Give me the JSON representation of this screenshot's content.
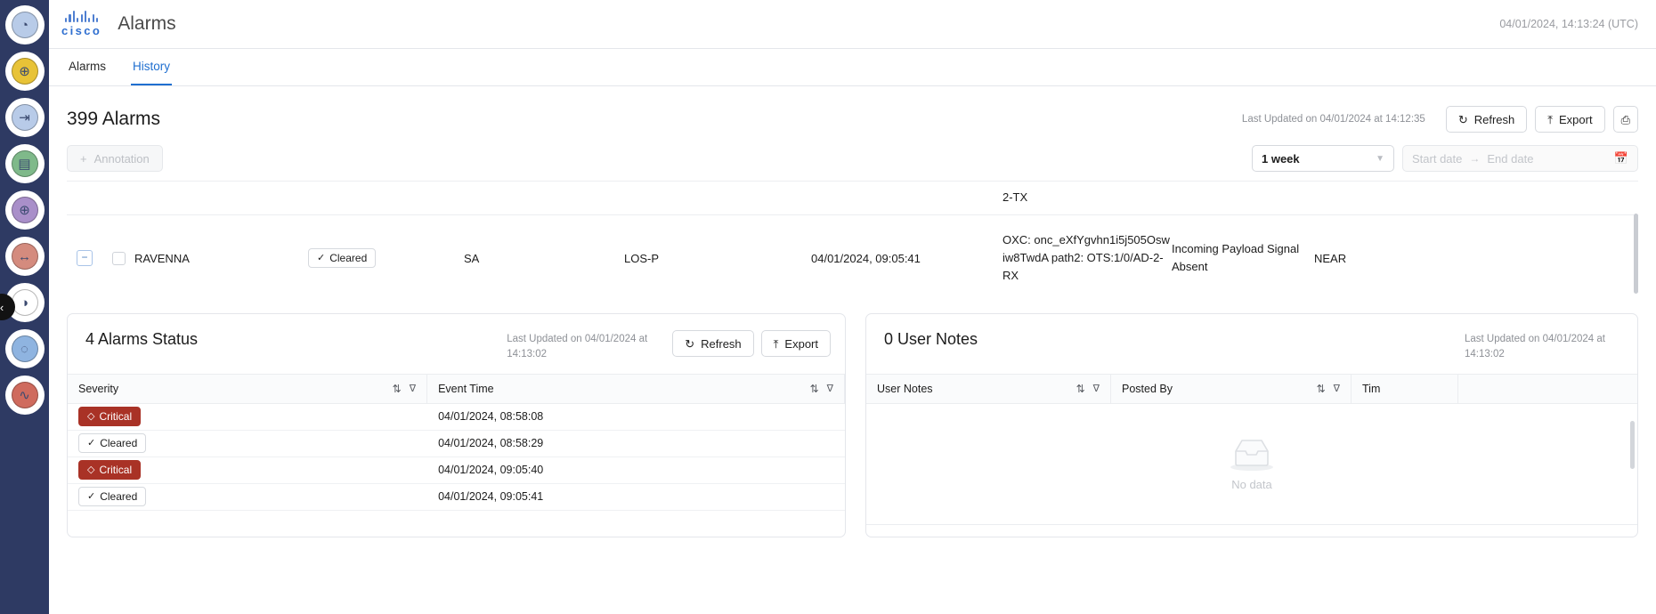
{
  "sidebar": {
    "items": [
      {
        "name": "globe-network-icon",
        "glyph": "◔",
        "color": "#b8cbe8"
      },
      {
        "name": "add-service-icon",
        "glyph": "⊕",
        "color": "#e8c337"
      },
      {
        "name": "import-device-icon",
        "glyph": "⇥",
        "color": "#b8cbe8"
      },
      {
        "name": "inventory-report-icon",
        "glyph": "▤",
        "color": "#7fb98a"
      },
      {
        "name": "add-circuit-icon",
        "glyph": "⊕",
        "color": "#a98fc9"
      },
      {
        "name": "link-status-icon",
        "glyph": "↔",
        "color": "#d48b7e"
      },
      {
        "name": "optical-power-icon",
        "glyph": "◑",
        "color": "#ffffff"
      },
      {
        "name": "topology-graph-icon",
        "glyph": "◌",
        "color": "#8fb4e0"
      },
      {
        "name": "alarm-monitor-icon",
        "glyph": "∿",
        "color": "#cf6b5e"
      }
    ],
    "collapse_glyph": "‹"
  },
  "header": {
    "brand": "cisco",
    "title": "Alarms",
    "timestamp": "04/01/2024, 14:13:24 (UTC)"
  },
  "tabs": [
    {
      "label": "Alarms",
      "active": false
    },
    {
      "label": "History",
      "active": true
    }
  ],
  "toolbar": {
    "count_title": "399 Alarms",
    "last_updated": "Last Updated on 04/01/2024 at 14:12:35",
    "refresh_label": "Refresh",
    "refresh_icon": "↻",
    "export_label": "Export",
    "export_icon": "⤒",
    "extra_icon": "⎙"
  },
  "filters": {
    "annotation_label": "Annotation",
    "annotation_icon": "+",
    "range_value": "1 week",
    "range_chevron": "⌄",
    "start_placeholder": "Start date",
    "range_arrow": "→",
    "end_placeholder": "End date",
    "calendar_icon": "Ὄ5"
  },
  "alarm_table": {
    "partial_row_above": "2-TX",
    "row": {
      "expand_icon": "−",
      "node": "RAVENNA",
      "severity": "Cleared",
      "severity_icon": "✓",
      "sa": "SA",
      "condition": "LOS-P",
      "event_time": "04/01/2024, 09:05:41",
      "resource": "OXC: onc_eXfYgvhn1i5j505Oswiw8TwdA path2: OTS:1/0/AD-2-RX",
      "description": "Incoming Payload Signal Absent",
      "direction": "NEAR"
    }
  },
  "alarms_status_panel": {
    "title": "4 Alarms Status",
    "last_updated": "Last Updated on 04/01/2024 at 14:13:02",
    "refresh_label": "Refresh",
    "refresh_icon": "↻",
    "export_label": "Export",
    "export_icon": "⤒",
    "columns": [
      {
        "label": "Severity",
        "sort_icon": "⇅",
        "filter_icon": "∇"
      },
      {
        "label": "Event Time",
        "sort_icon": "⇅",
        "filter_icon": "∇"
      }
    ],
    "rows": [
      {
        "severity": "Critical",
        "severity_icon": "◇",
        "severity_type": "critical",
        "event_time": "04/01/2024, 08:58:08"
      },
      {
        "severity": "Cleared",
        "severity_icon": "✓",
        "severity_type": "cleared",
        "event_time": "04/01/2024, 08:58:29"
      },
      {
        "severity": "Critical",
        "severity_icon": "◇",
        "severity_type": "critical",
        "event_time": "04/01/2024, 09:05:40"
      },
      {
        "severity": "Cleared",
        "severity_icon": "✓",
        "severity_type": "cleared",
        "event_time": "04/01/2024, 09:05:41"
      }
    ]
  },
  "user_notes_panel": {
    "title": "0 User Notes",
    "last_updated": "Last Updated on 04/01/2024 at 14:13:02",
    "columns": [
      {
        "label": "User Notes",
        "sort_icon": "⇅",
        "filter_icon": "∇"
      },
      {
        "label": "Posted By",
        "sort_icon": "⇅",
        "filter_icon": "∇"
      },
      {
        "label": "Tim",
        "sort_icon": "",
        "filter_icon": ""
      }
    ],
    "empty_label": "No data"
  },
  "colors": {
    "rail_bg": "#2e3a63",
    "accent": "#1f6fd0",
    "critical": "#a93226",
    "cisco_blue": "#2f6fd0"
  }
}
